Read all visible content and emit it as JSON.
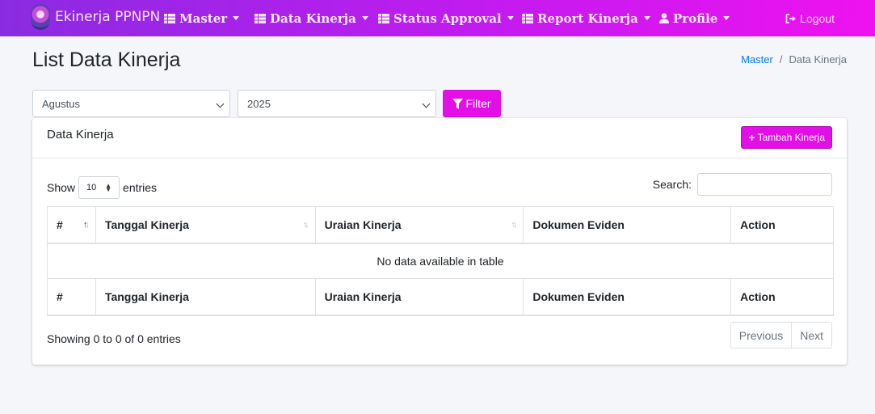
{
  "navbar": {
    "brand": "Ekinerja PPNPN",
    "items": [
      {
        "label": "Master",
        "icon": "table-icon"
      },
      {
        "label": "Data Kinerja",
        "icon": "table-icon"
      },
      {
        "label": "Status Approval",
        "icon": "table-icon"
      },
      {
        "label": "Report Kinerja",
        "icon": "table-icon"
      },
      {
        "label": "Profile",
        "icon": "user-icon"
      }
    ],
    "logout": "Logout"
  },
  "header": {
    "title": "List Data Kinerja",
    "breadcrumb": {
      "link": "Master",
      "separator": "/",
      "current": "Data Kinerja"
    }
  },
  "filter": {
    "month": "Agustus",
    "year": "2025",
    "button": "Filter"
  },
  "card": {
    "title": "Data Kinerja",
    "add_button": "Tambah Kinerja",
    "show_label": "Show",
    "entries_label": "entries",
    "page_length": "10",
    "search_label": "Search:",
    "columns": [
      "#",
      "Tanggal Kinerja",
      "Uraian Kinerja",
      "Dokumen Eviden",
      "Action"
    ],
    "empty_message": "No data available in table",
    "info": "Showing 0 to 0 of 0 entries",
    "pagination": {
      "previous": "Previous",
      "next": "Next"
    }
  },
  "colors": {
    "accent": "#e20fe6",
    "navbar_start": "#8a2be2",
    "navbar_end": "#ee12f0",
    "link": "#007bff"
  }
}
